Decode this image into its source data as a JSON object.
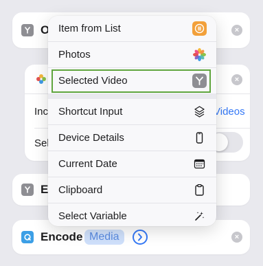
{
  "cards": {
    "top_title_partial": "O",
    "middle": {
      "row1_label_partial": "Inc",
      "row1_link_partial": "Videos",
      "row2_label_partial": "Sel"
    },
    "lower_title_partial": "E",
    "encode": {
      "title": "Encode",
      "token": "Media"
    }
  },
  "menu": {
    "items": [
      {
        "label": "Item from List",
        "icon": "list-icon"
      },
      {
        "label": "Photos",
        "icon": "photos-icon"
      },
      {
        "label": "Selected Video",
        "icon": "shortcut-y-icon",
        "selected": true
      },
      {
        "label": "Shortcut Input",
        "icon": "stack-icon"
      },
      {
        "label": "Device Details",
        "icon": "phone-icon"
      },
      {
        "label": "Current Date",
        "icon": "calendar-icon"
      },
      {
        "label": "Clipboard",
        "icon": "clipboard-icon"
      },
      {
        "label": "Select Variable",
        "icon": "magic-wand-icon"
      }
    ]
  },
  "colors": {
    "selection_outline": "#5fa53d",
    "accent_blue": "#3478f6",
    "list_icon_orange": "#f2a03a"
  }
}
